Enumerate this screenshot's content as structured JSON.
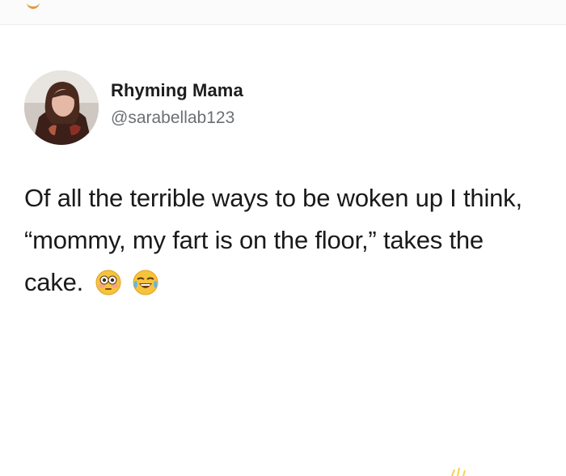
{
  "tweet": {
    "display_name": "Rhyming Mama",
    "handle": "@sarabellab123",
    "text": "Of all the terrible ways to be woken up I think, “mommy, my fart is on the floor,” takes the cake.",
    "emojis": [
      "flushed-face-icon",
      "tears-of-joy-icon"
    ]
  },
  "colors": {
    "name": "#1d1d1d",
    "handle": "#6b7075",
    "text": "#1a1a1a",
    "accent": "#e19a3a"
  }
}
